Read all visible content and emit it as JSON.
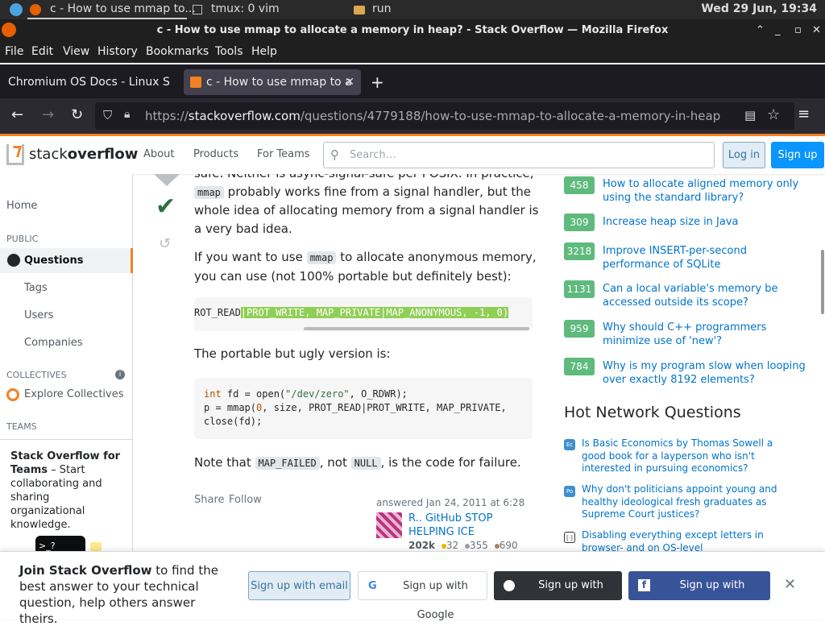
{
  "system": {
    "tab1": "c - How to use mmap to...",
    "tab2": "tmux: 0 vim",
    "tab3": "run",
    "clock": "Wed 29 Jun, 19:34"
  },
  "window": {
    "title": "c - How to use mmap to allocate a memory in heap? - Stack Overflow — Mozilla Firefox"
  },
  "menu": [
    "File",
    "Edit",
    "View",
    "History",
    "Bookmarks",
    "Tools",
    "Help"
  ],
  "tabs": [
    {
      "label": "Chromium OS Docs - Linux S"
    },
    {
      "label": "c - How to use mmap to a"
    }
  ],
  "url": {
    "prefix": "https://",
    "domain": "stackoverflow.com",
    "path": "/questions/4779188/how-to-use-mmap-to-allocate-a-memory-in-heap"
  },
  "so": {
    "logo_a": "stack",
    "logo_b": "overflow",
    "nav": [
      "About",
      "Products",
      "For Teams"
    ],
    "search_placeholder": "Search…",
    "login": "Log in",
    "signup": "Sign up"
  },
  "sidebar": {
    "home": "Home",
    "public": "PUBLIC",
    "questions": "Questions",
    "tags": "Tags",
    "users": "Users",
    "companies": "Companies",
    "collectives": "COLLECTIVES",
    "explore": "Explore Collectives",
    "teams": "TEAMS",
    "teams_title": "Stack Overflow for Teams",
    "teams_text": " – Start collaborating and sharing organizational knowledge."
  },
  "answer": {
    "p0a": "safe. Neither is async-signal-safe per POSIX. In practice,",
    "p0_code": "mmap",
    "p0b": " probably works fine from a signal handler, but the whole idea of allocating memory from a signal handler is a very bad idea.",
    "p1a": "If you want to use ",
    "p1_code": "mmap",
    "p1b": " to allocate anonymous memory, you can use (not 100% portable but definitely best):",
    "code1_plain": "ROT_READ",
    "code1_sel": "|PROT_WRITE, MAP_PRIVATE|MAP_ANONYMOUS, -1, 0)",
    "p2": "The portable but ugly version is:",
    "code2_l1a": "int",
    "code2_l1b": " fd = open(",
    "code2_l1c": "\"/dev/zero\"",
    "code2_l1d": ", O_RDWR);",
    "code2_l2a": "p = mmap(",
    "code2_l2b": "0",
    "code2_l2c": ", size, PROT_READ|PROT_WRITE, MAP_PRIVATE,",
    "code2_l3": "close(fd);",
    "p3a": "Note that ",
    "p3_code1": "MAP_FAILED",
    "p3b": ", not ",
    "p3_code2": "NULL",
    "p3c": ", is the code for failure.",
    "share": "Share",
    "follow": "Follow",
    "answered": "answered Jan 24, 2011 at 6:28",
    "user": "R.. GitHub STOP HELPING ICE",
    "rep": "202k",
    "gold": "32",
    "silver": "355",
    "bronze": "690"
  },
  "related": [
    {
      "score": "458",
      "title": "How to allocate aligned memory only using the standard library?"
    },
    {
      "score": "309",
      "title": "Increase heap size in Java"
    },
    {
      "score": "3218",
      "title": "Improve INSERT-per-second performance of SQLite"
    },
    {
      "score": "1131",
      "title": "Can a local variable's memory be accessed outside its scope?"
    },
    {
      "score": "959",
      "title": "Why should C++ programmers minimize use of 'new'?"
    },
    {
      "score": "784",
      "title": "Why is my program slow when looping over exactly 8192 elements?"
    }
  ],
  "hnq": {
    "heading": "Hot Network Questions",
    "items": [
      {
        "title": "Is Basic Economics by Thomas Sowell a good book for a layperson who isn't interested in pursuing economics?"
      },
      {
        "title": "Why don't politicians appoint young and healthy ideological fresh graduates as Supreme Court justices?"
      },
      {
        "title": "Disabling everything except letters in browser- and on OS-level"
      }
    ]
  },
  "banner": {
    "bold": "Join Stack Overflow",
    "text": " to find the best answer to your technical question, help others answer theirs.",
    "email": "Sign up with email",
    "google": "Sign up with Google",
    "github": "Sign up with GitHub",
    "facebook": "Sign up with Facebook"
  }
}
